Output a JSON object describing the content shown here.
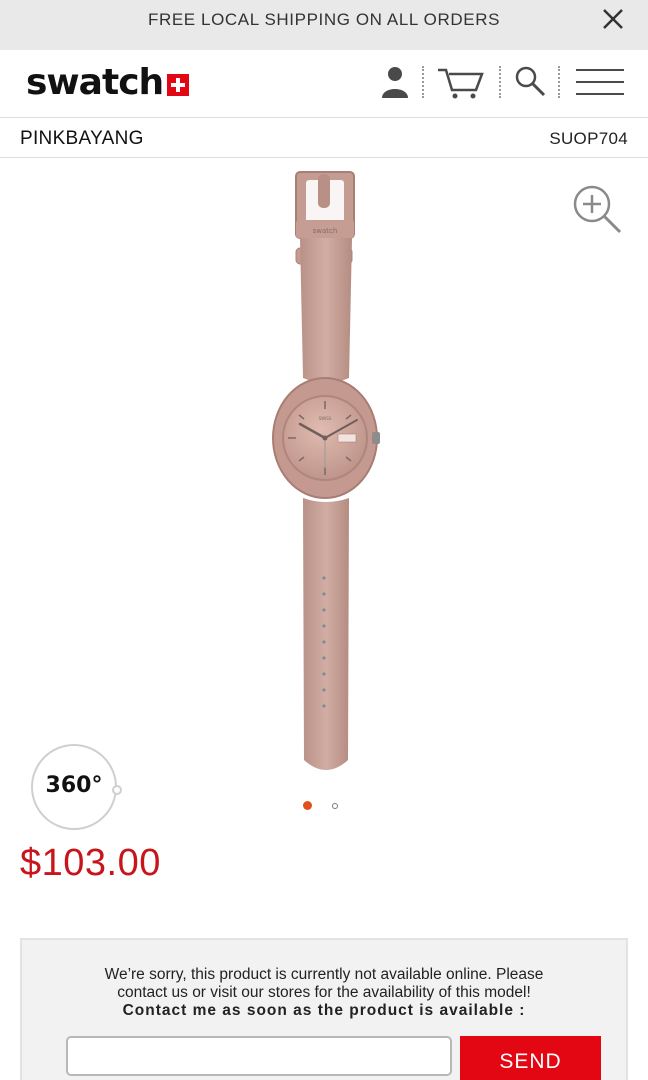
{
  "banner": {
    "text": "FREE LOCAL SHIPPING ON ALL ORDERS",
    "close_icon": "close-icon"
  },
  "header": {
    "logo_text": "swatch",
    "icons": [
      "account-icon",
      "cart-icon",
      "search-icon",
      "menu-icon"
    ]
  },
  "product": {
    "name": "PINKBAYANG",
    "code": "SUOP704",
    "price": "$103.00",
    "view_360_label": "360°",
    "gallery": {
      "total_images": 2,
      "active_index": 0
    }
  },
  "availability": {
    "line1": "We’re sorry, this product is currently not available online. Please",
    "line2": "contact us or visit our stores for the availability of this model!",
    "line3": "Contact me as soon as the product is available :",
    "email_value": "",
    "send_label": "SEND"
  },
  "colors": {
    "accent_red": "#e30613",
    "price_red": "#c8151b",
    "active_dot": "#e0501e",
    "banner_bg": "#e9e9e9",
    "watch_pink": "#c9a49a"
  }
}
